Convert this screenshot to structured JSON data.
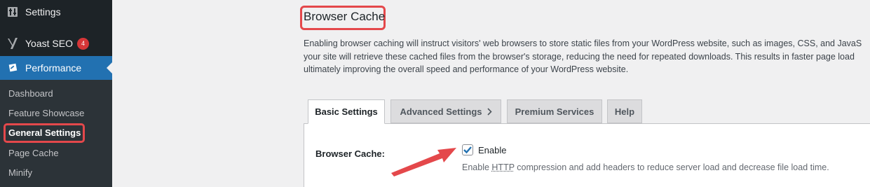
{
  "sidebar": {
    "settings_label": "Settings",
    "yoast_label": "Yoast SEO",
    "yoast_badge": "4",
    "performance_label": "Performance",
    "submenu": [
      "Dashboard",
      "Feature Showcase",
      "General Settings",
      "Page Cache",
      "Minify"
    ],
    "current_submenu": "General Settings"
  },
  "main": {
    "title": "Browser Cache",
    "description": [
      "Enabling browser caching will instruct visitors' web browsers to store static files from your WordPress website, such as images, CSS, and JavaS",
      "your site will retrieve these cached files from the browser's storage, reducing the need for repeated downloads. This results in faster page load",
      "ultimately improving the overall speed and performance of your WordPress website."
    ],
    "tabs": [
      {
        "label": "Basic Settings",
        "active": true
      },
      {
        "label": "Advanced Settings",
        "active": false
      },
      {
        "label": "Premium Services",
        "active": false
      },
      {
        "label": "Help",
        "active": false
      }
    ],
    "field": {
      "label": "Browser Cache:",
      "checkbox_label": "Enable",
      "checked": true,
      "help_prefix": "Enable ",
      "help_abbr": "HTTP",
      "help_suffix": " compression and add headers to reduce server load and decrease file load time."
    }
  },
  "colors": {
    "highlight": "#e4484b",
    "accent": "#2271b1",
    "sidebar_bg": "#1d2327"
  }
}
